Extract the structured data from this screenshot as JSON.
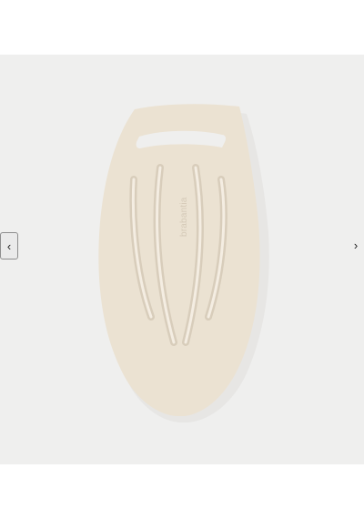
{
  "gallery": {
    "prev_icon": "‹",
    "next_icon": "›",
    "prev_icon_name": "chevron-left-icon",
    "next_icon_name": "chevron-right-icon",
    "product_brand": "brabantia",
    "background_color": "#efefee",
    "product_color": "#ebe2d2",
    "product_shadow_color": "#d8cdbb"
  }
}
